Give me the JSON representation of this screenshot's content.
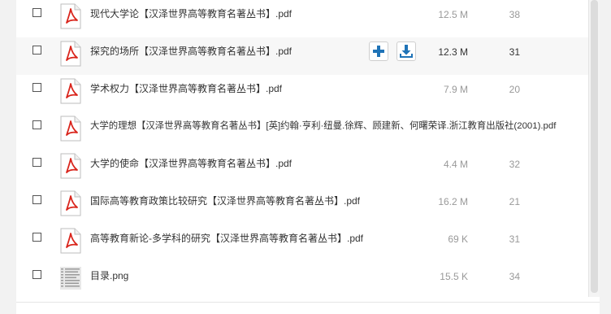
{
  "files": [
    {
      "name": "现代大学论【汉泽世界高等教育名著丛书】.pdf",
      "size": "12.5 M",
      "downloads": "38",
      "icon": "pdf-icon"
    },
    {
      "name": "探究的场所【汉泽世界高等教育名著丛书】.pdf",
      "size": "12.3 M",
      "downloads": "31",
      "icon": "pdf-icon",
      "hovered": true
    },
    {
      "name": "学术权力【汉泽世界高等教育名著丛书】.pdf",
      "size": "7.9 M",
      "downloads": "20",
      "icon": "pdf-icon"
    },
    {
      "name": "大学的理想【汉泽世界高等教育名著丛书】[英]约翰·亨利·纽曼.徐辉、顾建新、何曙荣译.浙江教育出版社(2001).pdf",
      "size": "",
      "downloads": "",
      "icon": "pdf-icon"
    },
    {
      "name": "大学的使命【汉泽世界高等教育名著丛书】.pdf",
      "size": "4.4 M",
      "downloads": "32",
      "icon": "pdf-icon"
    },
    {
      "name": "国际高等教育政策比较研究【汉泽世界高等教育名著丛书】.pdf",
      "size": "16.2 M",
      "downloads": "21",
      "icon": "pdf-icon"
    },
    {
      "name": "高等教育新论-多学科的研究【汉泽世界高等教育名著丛书】.pdf",
      "size": "69 K",
      "downloads": "31",
      "icon": "pdf-icon"
    },
    {
      "name": "目录.png",
      "size": "15.5 K",
      "downloads": "34",
      "icon": "image-thumbnail-icon"
    }
  ],
  "colors": {
    "pdf_red": "#d9241b",
    "action_blue": "#1f73b7",
    "muted_text": "#999999"
  }
}
